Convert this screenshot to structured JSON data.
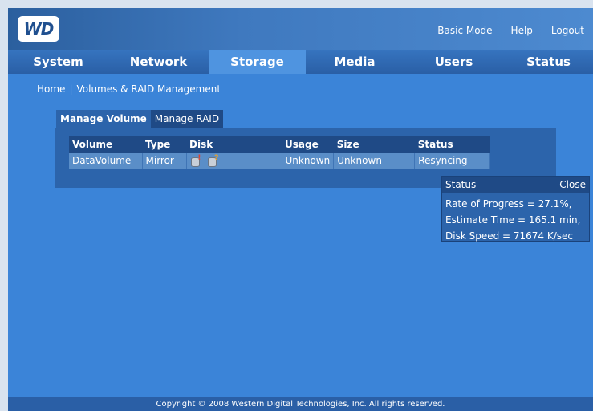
{
  "header": {
    "logo_text": "WD",
    "links": [
      "Basic Mode",
      "Help",
      "Logout"
    ]
  },
  "nav": {
    "tabs": [
      {
        "label": "System"
      },
      {
        "label": "Network"
      },
      {
        "label": "Storage",
        "active": true
      },
      {
        "label": "Media"
      },
      {
        "label": "Users"
      },
      {
        "label": "Status"
      }
    ]
  },
  "breadcrumb": {
    "home": "Home",
    "current": "Volumes & RAID Management"
  },
  "subtabs": {
    "manage_volume": "Manage Volume",
    "manage_raid": "Manage RAID"
  },
  "table": {
    "headers": [
      "Volume",
      "Type",
      "Disk",
      "Usage",
      "Size",
      "Status"
    ],
    "rows": [
      {
        "volume": "DataVolume",
        "type": "Mirror",
        "disk_icons": [
          "disk-ok-icon",
          "disk-warning-icon"
        ],
        "usage": "Unknown",
        "size": "Unknown",
        "status": "Resyncing"
      }
    ]
  },
  "status_popup": {
    "title": "Status",
    "close": "Close",
    "lines": [
      "Rate of Progress = 27.1%,",
      "Estimate Time = 165.1 min,",
      "Disk Speed = 71674 K/sec"
    ]
  },
  "footer": {
    "text": "Copyright © 2008 Western Digital Technologies, Inc. All rights reserved."
  },
  "colors": {
    "page_background": "#3b84d8",
    "nav_active": "#4f94e0",
    "panel": "#2c64ab",
    "table_header": "#1f4a86"
  }
}
